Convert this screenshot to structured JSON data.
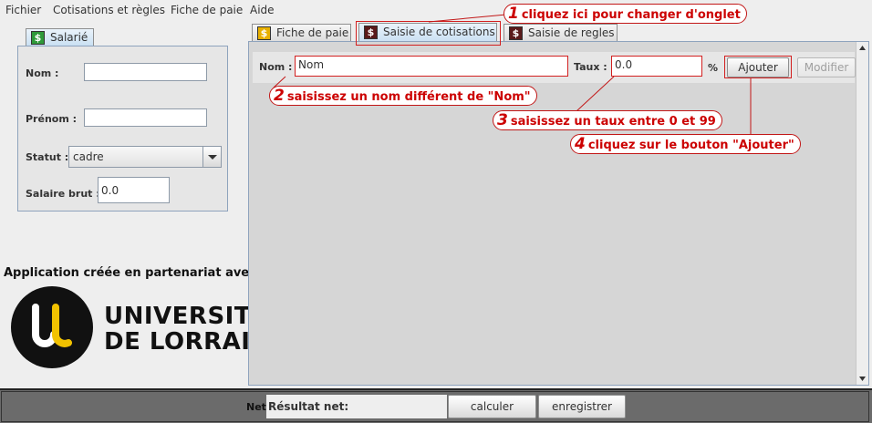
{
  "menu": [
    "Fichier",
    "Cotisations et règles",
    "Fiche de paie",
    "Aide"
  ],
  "left_panel": {
    "tab_label": "Salarié",
    "nom_label": "Nom :",
    "nom_value": "",
    "prenom_label": "Prénom :",
    "prenom_value": "",
    "statut_label": "Statut :",
    "statut_value": "cadre",
    "salaire_label": "Salaire brut :",
    "salaire_value": "0.0"
  },
  "partner_text": "Application créée en partenariat avec:",
  "logo": {
    "line1": "UNIVERSITÉ",
    "line2": "DE LORRAINE"
  },
  "tabs": [
    {
      "label": "Fiche de paie",
      "active": false
    },
    {
      "label": "Saisie de cotisations",
      "active": true
    },
    {
      "label": "Saisie de regles",
      "active": false
    }
  ],
  "form": {
    "nom_label": "Nom :",
    "nom_value": "Nom",
    "taux_label": "Taux :",
    "taux_value": "0.0",
    "percent": "%",
    "add_button": "Ajouter",
    "modify_button": "Modifier"
  },
  "callouts": [
    {
      "num": "1",
      "text": "cliquez ici pour changer d'onglet"
    },
    {
      "num": "2",
      "text": "saisissez un nom différent de \"Nom\""
    },
    {
      "num": "3",
      "text": "saisissez un taux entre 0 et 99"
    },
    {
      "num": "4",
      "text": "cliquez sur le bouton \"Ajouter\""
    }
  ],
  "bottom": {
    "net_label": "Net",
    "result_value": "Résultat net:",
    "calc_button": "calculer",
    "save_button": "enregistrer"
  },
  "colors": {
    "annotation_red": "#cc0000",
    "panel_bg": "#d6d6d6",
    "bottom_bar": "#6b6b6b"
  }
}
